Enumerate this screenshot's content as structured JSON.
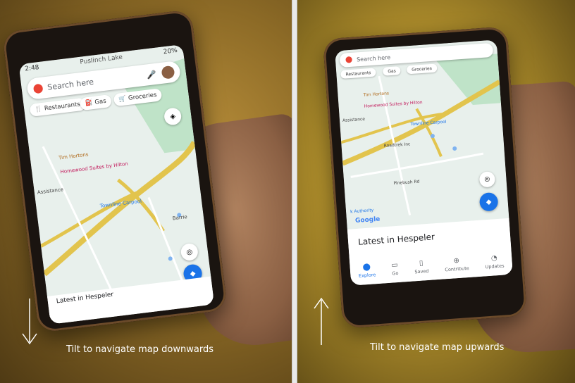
{
  "left": {
    "caption": "Tilt to navigate map downwards",
    "phone": {
      "status_time": "2:48",
      "status_battery": "20%",
      "top_place": "Puslinch Lake",
      "search_placeholder": "Search here",
      "chips": [
        "Restaurants",
        "Gas",
        "Groceries"
      ],
      "map_labels": [
        "Tim Hortons",
        "Homewood Suites by Hilton",
        "Townline Carpool",
        "Barrie",
        "Assistance"
      ],
      "sheet_title": "Latest in Hespeler"
    }
  },
  "right": {
    "caption": "Tilt to navigate map upwards",
    "phone": {
      "search_placeholder": "Search here",
      "chips": [
        "Restaurants",
        "Gas",
        "Groceries"
      ],
      "map_labels": [
        "Tim Hortons",
        "Homewood Suites by Hilton",
        "Townline Carpool",
        "Roadtrek Inc",
        "Pinebush Rd",
        "Assistance",
        "k Authority"
      ],
      "google_logo": "Google",
      "sheet_title": "Latest in Hespeler",
      "nav": [
        {
          "label": "Explore",
          "icon": "location-pin-icon",
          "active": true
        },
        {
          "label": "Go",
          "icon": "car-icon",
          "active": false
        },
        {
          "label": "Saved",
          "icon": "bookmark-icon",
          "active": false
        },
        {
          "label": "Contribute",
          "icon": "plus-circle-icon",
          "active": false
        },
        {
          "label": "Updates",
          "icon": "bell-icon",
          "active": false
        }
      ]
    }
  },
  "colors": {
    "map_bg": "#e8f0ec",
    "highway": "#e2c44d",
    "accent_blue": "#1a73e8",
    "park_green": "#bfe3c8"
  }
}
